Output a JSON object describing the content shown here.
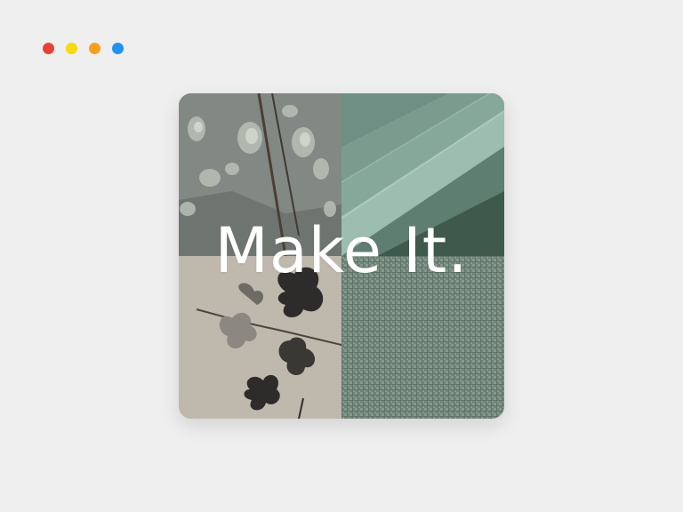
{
  "loader": {
    "dots": [
      {
        "color": "#e94234"
      },
      {
        "color": "#f9d90f"
      },
      {
        "color": "#f7a01c"
      },
      {
        "color": "#2391f0"
      }
    ]
  },
  "card": {
    "headline": "Make It.",
    "tiles": [
      {
        "icon": "lichen-rock-image"
      },
      {
        "icon": "green-leaf-image"
      },
      {
        "icon": "hibiscus-flower-image"
      },
      {
        "icon": "woven-fabric-image"
      }
    ]
  }
}
